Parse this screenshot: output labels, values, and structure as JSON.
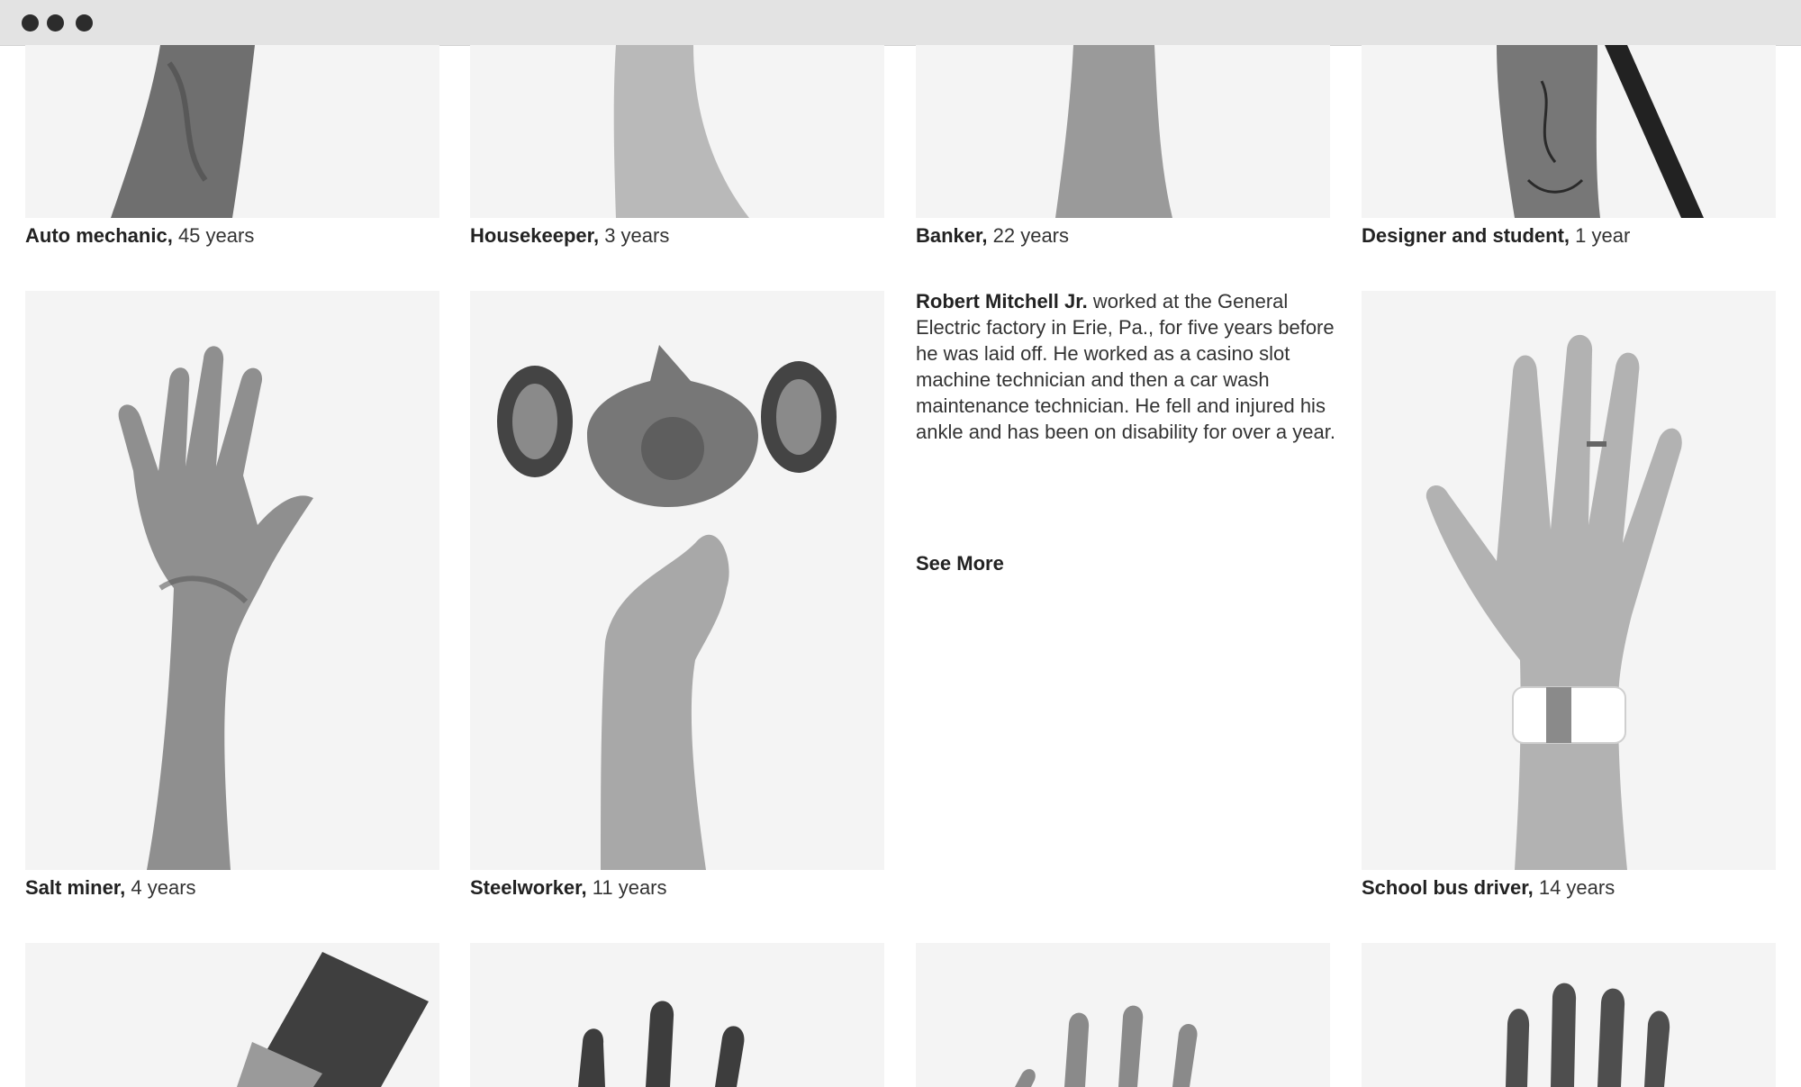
{
  "window": {
    "controls": [
      "window-dot",
      "window-dot",
      "window-dot"
    ]
  },
  "rows": [
    [
      {
        "occupation": "Auto mechanic,",
        "tenure": "45 years"
      },
      {
        "occupation": "Housekeeper,",
        "tenure": "3 years"
      },
      {
        "occupation": "Banker,",
        "tenure": "22 years"
      },
      {
        "occupation": "Designer and student,",
        "tenure": "1 year"
      }
    ],
    [
      {
        "occupation": "Salt miner,",
        "tenure": "4 years"
      },
      {
        "occupation": "Steelworker,",
        "tenure": "11 years"
      },
      {
        "occupation": "School bus driver,",
        "tenure": "14 years"
      }
    ]
  ],
  "bio": {
    "name": "Robert Mitchell Jr.",
    "text": " worked at the General Electric factory in Erie, Pa., for five years before he was laid off. He worked as a casino slot machine technician and then a car wash maintenance technician. He fell and injured his ankle and has been on disability for over a year.",
    "see_more": "See More"
  },
  "colors": {
    "photo_background": "#f4f4f4",
    "titlebar": "#e3e3e3"
  }
}
